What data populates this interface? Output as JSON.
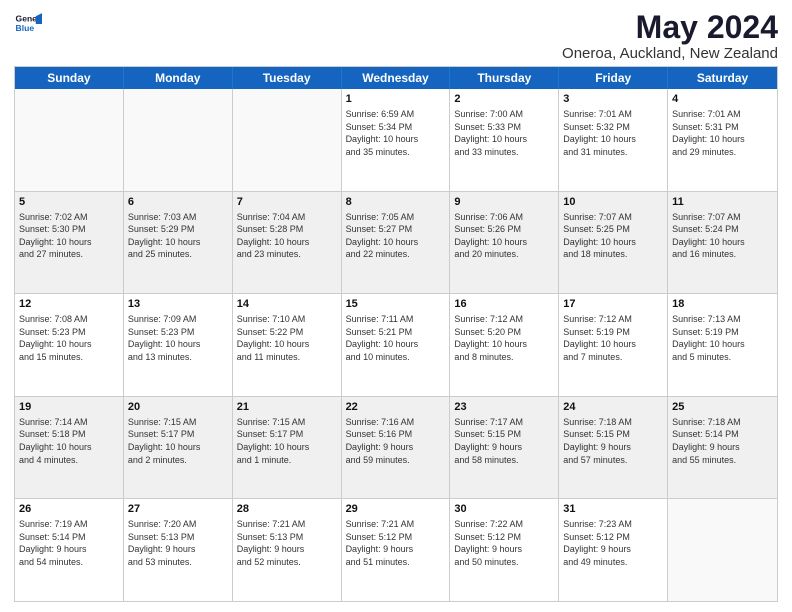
{
  "header": {
    "logo_line1": "General",
    "logo_line2": "Blue",
    "title": "May 2024",
    "subtitle": "Oneroa, Auckland, New Zealand"
  },
  "dayHeaders": [
    "Sunday",
    "Monday",
    "Tuesday",
    "Wednesday",
    "Thursday",
    "Friday",
    "Saturday"
  ],
  "weeks": [
    {
      "days": [
        {
          "num": "",
          "empty": true
        },
        {
          "num": "",
          "empty": true
        },
        {
          "num": "",
          "empty": true
        },
        {
          "num": "1",
          "lines": [
            "Sunrise: 6:59 AM",
            "Sunset: 5:34 PM",
            "Daylight: 10 hours",
            "and 35 minutes."
          ]
        },
        {
          "num": "2",
          "lines": [
            "Sunrise: 7:00 AM",
            "Sunset: 5:33 PM",
            "Daylight: 10 hours",
            "and 33 minutes."
          ]
        },
        {
          "num": "3",
          "lines": [
            "Sunrise: 7:01 AM",
            "Sunset: 5:32 PM",
            "Daylight: 10 hours",
            "and 31 minutes."
          ]
        },
        {
          "num": "4",
          "lines": [
            "Sunrise: 7:01 AM",
            "Sunset: 5:31 PM",
            "Daylight: 10 hours",
            "and 29 minutes."
          ]
        }
      ]
    },
    {
      "shaded": true,
      "days": [
        {
          "num": "5",
          "lines": [
            "Sunrise: 7:02 AM",
            "Sunset: 5:30 PM",
            "Daylight: 10 hours",
            "and 27 minutes."
          ]
        },
        {
          "num": "6",
          "lines": [
            "Sunrise: 7:03 AM",
            "Sunset: 5:29 PM",
            "Daylight: 10 hours",
            "and 25 minutes."
          ]
        },
        {
          "num": "7",
          "lines": [
            "Sunrise: 7:04 AM",
            "Sunset: 5:28 PM",
            "Daylight: 10 hours",
            "and 23 minutes."
          ]
        },
        {
          "num": "8",
          "lines": [
            "Sunrise: 7:05 AM",
            "Sunset: 5:27 PM",
            "Daylight: 10 hours",
            "and 22 minutes."
          ]
        },
        {
          "num": "9",
          "lines": [
            "Sunrise: 7:06 AM",
            "Sunset: 5:26 PM",
            "Daylight: 10 hours",
            "and 20 minutes."
          ]
        },
        {
          "num": "10",
          "lines": [
            "Sunrise: 7:07 AM",
            "Sunset: 5:25 PM",
            "Daylight: 10 hours",
            "and 18 minutes."
          ]
        },
        {
          "num": "11",
          "lines": [
            "Sunrise: 7:07 AM",
            "Sunset: 5:24 PM",
            "Daylight: 10 hours",
            "and 16 minutes."
          ]
        }
      ]
    },
    {
      "days": [
        {
          "num": "12",
          "lines": [
            "Sunrise: 7:08 AM",
            "Sunset: 5:23 PM",
            "Daylight: 10 hours",
            "and 15 minutes."
          ]
        },
        {
          "num": "13",
          "lines": [
            "Sunrise: 7:09 AM",
            "Sunset: 5:23 PM",
            "Daylight: 10 hours",
            "and 13 minutes."
          ]
        },
        {
          "num": "14",
          "lines": [
            "Sunrise: 7:10 AM",
            "Sunset: 5:22 PM",
            "Daylight: 10 hours",
            "and 11 minutes."
          ]
        },
        {
          "num": "15",
          "lines": [
            "Sunrise: 7:11 AM",
            "Sunset: 5:21 PM",
            "Daylight: 10 hours",
            "and 10 minutes."
          ]
        },
        {
          "num": "16",
          "lines": [
            "Sunrise: 7:12 AM",
            "Sunset: 5:20 PM",
            "Daylight: 10 hours",
            "and 8 minutes."
          ]
        },
        {
          "num": "17",
          "lines": [
            "Sunrise: 7:12 AM",
            "Sunset: 5:19 PM",
            "Daylight: 10 hours",
            "and 7 minutes."
          ]
        },
        {
          "num": "18",
          "lines": [
            "Sunrise: 7:13 AM",
            "Sunset: 5:19 PM",
            "Daylight: 10 hours",
            "and 5 minutes."
          ]
        }
      ]
    },
    {
      "shaded": true,
      "days": [
        {
          "num": "19",
          "lines": [
            "Sunrise: 7:14 AM",
            "Sunset: 5:18 PM",
            "Daylight: 10 hours",
            "and 4 minutes."
          ]
        },
        {
          "num": "20",
          "lines": [
            "Sunrise: 7:15 AM",
            "Sunset: 5:17 PM",
            "Daylight: 10 hours",
            "and 2 minutes."
          ]
        },
        {
          "num": "21",
          "lines": [
            "Sunrise: 7:15 AM",
            "Sunset: 5:17 PM",
            "Daylight: 10 hours",
            "and 1 minute."
          ]
        },
        {
          "num": "22",
          "lines": [
            "Sunrise: 7:16 AM",
            "Sunset: 5:16 PM",
            "Daylight: 9 hours",
            "and 59 minutes."
          ]
        },
        {
          "num": "23",
          "lines": [
            "Sunrise: 7:17 AM",
            "Sunset: 5:15 PM",
            "Daylight: 9 hours",
            "and 58 minutes."
          ]
        },
        {
          "num": "24",
          "lines": [
            "Sunrise: 7:18 AM",
            "Sunset: 5:15 PM",
            "Daylight: 9 hours",
            "and 57 minutes."
          ]
        },
        {
          "num": "25",
          "lines": [
            "Sunrise: 7:18 AM",
            "Sunset: 5:14 PM",
            "Daylight: 9 hours",
            "and 55 minutes."
          ]
        }
      ]
    },
    {
      "days": [
        {
          "num": "26",
          "lines": [
            "Sunrise: 7:19 AM",
            "Sunset: 5:14 PM",
            "Daylight: 9 hours",
            "and 54 minutes."
          ]
        },
        {
          "num": "27",
          "lines": [
            "Sunrise: 7:20 AM",
            "Sunset: 5:13 PM",
            "Daylight: 9 hours",
            "and 53 minutes."
          ]
        },
        {
          "num": "28",
          "lines": [
            "Sunrise: 7:21 AM",
            "Sunset: 5:13 PM",
            "Daylight: 9 hours",
            "and 52 minutes."
          ]
        },
        {
          "num": "29",
          "lines": [
            "Sunrise: 7:21 AM",
            "Sunset: 5:12 PM",
            "Daylight: 9 hours",
            "and 51 minutes."
          ]
        },
        {
          "num": "30",
          "lines": [
            "Sunrise: 7:22 AM",
            "Sunset: 5:12 PM",
            "Daylight: 9 hours",
            "and 50 minutes."
          ]
        },
        {
          "num": "31",
          "lines": [
            "Sunrise: 7:23 AM",
            "Sunset: 5:12 PM",
            "Daylight: 9 hours",
            "and 49 minutes."
          ]
        },
        {
          "num": "",
          "empty": true
        }
      ]
    }
  ]
}
